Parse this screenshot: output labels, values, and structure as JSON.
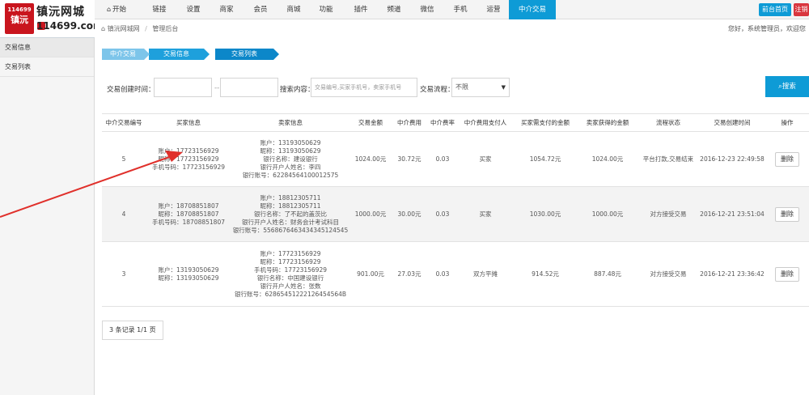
{
  "logo": {
    "seal_top": "114699",
    "seal_bottom": "镇沅",
    "name": "镇沅网城",
    "url": "114699.com"
  },
  "nav": [
    {
      "label": "开始",
      "icon": "home-icon"
    },
    {
      "label": "链接"
    },
    {
      "label": "设置"
    },
    {
      "label": "商家"
    },
    {
      "label": "会员"
    },
    {
      "label": "商城"
    },
    {
      "label": "功能"
    },
    {
      "label": "插件"
    },
    {
      "label": "频道"
    },
    {
      "label": "微信"
    },
    {
      "label": "手机"
    },
    {
      "label": "运营"
    },
    {
      "label": "中介交易",
      "active": true
    }
  ],
  "top_buttons": {
    "home": "前台首页",
    "logout": "注销"
  },
  "breadcrumb": {
    "site": "镇沅网城网",
    "section": "管理后台"
  },
  "welcome": "您好，系统管理员，欢迎您",
  "sidebar": [
    {
      "label": "交易信息",
      "active": true
    },
    {
      "label": "交易列表"
    }
  ],
  "steps": [
    "中介交易",
    "交易信息",
    "交易列表"
  ],
  "filter": {
    "time_label": "交易创建时间：",
    "dash": "--",
    "search_label": "搜索内容：",
    "search_placeholder": "交易编号,买家手机号，卖家手机号",
    "flow_label": "交易流程：",
    "flow_value": "不限",
    "search_button": "搜索"
  },
  "table": {
    "headers": [
      "中介交易编号",
      "买家信息",
      "卖家信息",
      "交易金额",
      "中介费用",
      "中介费率",
      "中介费用支付人",
      "买家需支付的金额",
      "卖家获得的金额",
      "流程状态",
      "交易创建时间",
      "操作"
    ],
    "rows": [
      {
        "id": "5",
        "buyer": [
          "账户：17723156929",
          "昵称：17723156929",
          "手机号码：17723156929"
        ],
        "seller": [
          "账户：13193050629",
          "昵称：13193050629",
          "银行名称：建设银行",
          "银行开户人姓名：李四",
          "银行账号：62284564100012575"
        ],
        "amount": "1024.00元",
        "fee": "30.72元",
        "rate": "0.03",
        "payer": "买家",
        "buyer_pay": "1054.72元",
        "seller_get": "1024.00元",
        "status": "平台打款,交易结束",
        "created": "2016-12-23 22:49:58",
        "action": "删除"
      },
      {
        "id": "4",
        "buyer": [
          "账户：18708851807",
          "昵称：18708851807",
          "手机号码：18708851807"
        ],
        "seller": [
          "账户：18812305711",
          "昵称：18812305711",
          "银行名称：了不起的盖茨比",
          "银行开户人姓名：财务会计考试科目",
          "银行账号：5568676463434345124545"
        ],
        "amount": "1000.00元",
        "fee": "30.00元",
        "rate": "0.03",
        "payer": "买家",
        "buyer_pay": "1030.00元",
        "seller_get": "1000.00元",
        "status": "对方接受交易",
        "created": "2016-12-21 23:51:04",
        "action": "删除"
      },
      {
        "id": "3",
        "buyer": [
          "账户：13193050629",
          "昵称：13193050629"
        ],
        "seller": [
          "账户：17723156929",
          "昵称：17723156929",
          "手机号码：17723156929",
          "银行名称：中国建设银行",
          "银行开户人姓名：张数",
          "银行账号：62865451222126454564B"
        ],
        "amount": "901.00元",
        "fee": "27.03元",
        "rate": "0.03",
        "payer": "双方平摊",
        "buyer_pay": "914.52元",
        "seller_get": "887.48元",
        "status": "对方接受交易",
        "created": "2016-12-21 23:36:42",
        "action": "删除"
      }
    ]
  },
  "pager": "3 条记录 1/1 页",
  "colors": {
    "accent": "#0e9bd6",
    "annotation_arrow": "#e0302b",
    "logo_red": "#c9151e"
  }
}
